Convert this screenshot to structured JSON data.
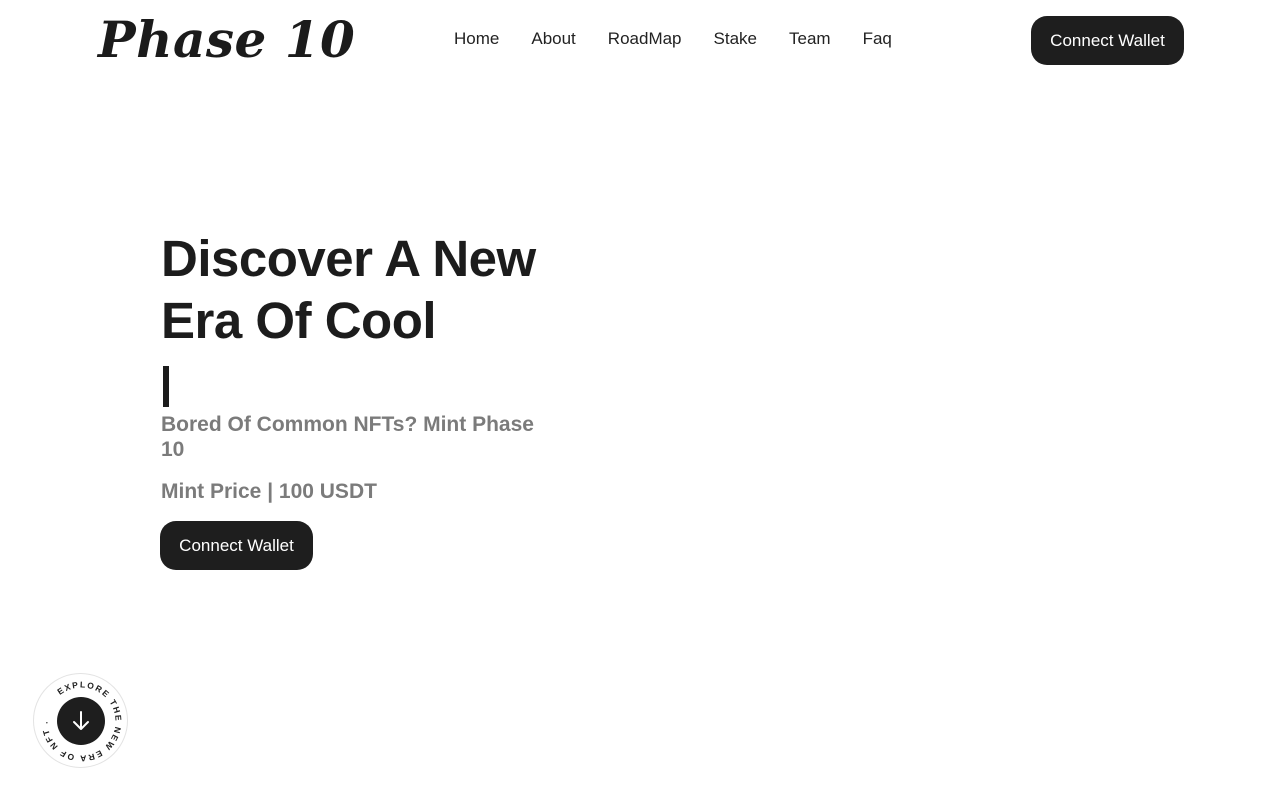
{
  "header": {
    "logo": "Phase 10",
    "nav": [
      "Home",
      "About",
      "RoadMap",
      "Stake",
      "Team",
      "Faq"
    ],
    "connect_label": "Connect Wallet"
  },
  "hero": {
    "title_line1": "Discover A New",
    "title_line2": "Era Of Cool",
    "subtitle": "Bored Of Common NFTs? Mint Phase 10",
    "price": "Mint Price | 100 USDT",
    "connect_label": "Connect Wallet"
  },
  "scroll_badge": {
    "ring_text": "EXPLORE THE NEW ERA OF NFT .",
    "icon": "arrow-down-icon"
  }
}
